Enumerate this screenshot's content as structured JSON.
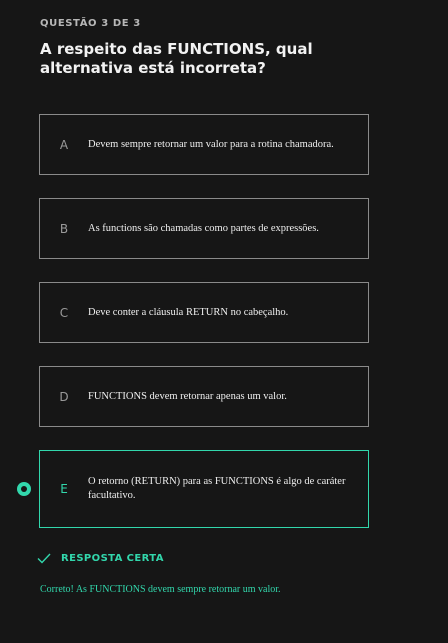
{
  "header": {
    "counter": "QUESTÃO 3 DE 3",
    "question": "A respeito das FUNCTIONS, qual alternativa está incorreta?"
  },
  "options": [
    {
      "letter": "A",
      "text": "Devem sempre retornar um valor para a rotina chamadora."
    },
    {
      "letter": "B",
      "text": "As functions são chamadas como partes de expressões."
    },
    {
      "letter": "C",
      "text": "Deve conter a cláusula RETURN no cabeçalho."
    },
    {
      "letter": "D",
      "text": "FUNCTIONS devem retornar apenas um valor."
    },
    {
      "letter": "E",
      "text": "O retorno (RETURN) para as FUNCTIONS é algo de caráter facultativo."
    }
  ],
  "selected_option": "E",
  "result": {
    "label": "RESPOSTA CERTA",
    "feedback": "Correto! As FUNCTIONS devem sempre retornar um valor.",
    "icon": "check-icon"
  },
  "colors": {
    "accent": "#32d7ac",
    "background": "#161616",
    "border": "#8a8a8a"
  }
}
